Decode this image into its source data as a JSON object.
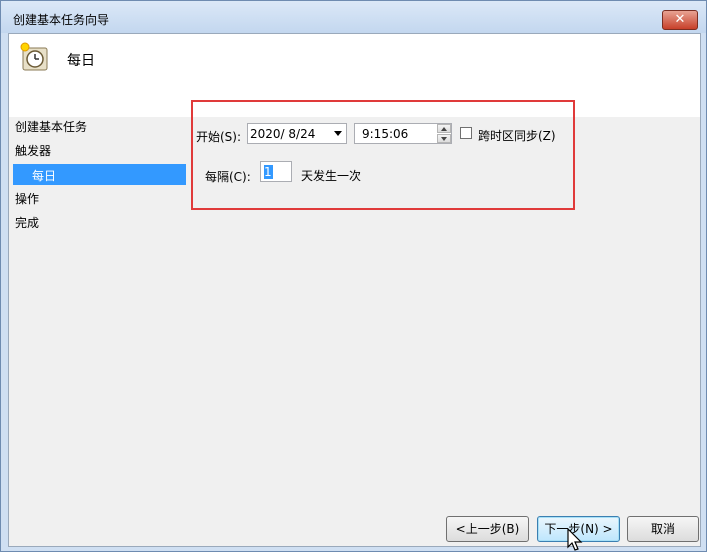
{
  "window": {
    "title": "创建基本任务向导",
    "close_symbol": "✕"
  },
  "header": {
    "title": "每日",
    "icon": "clock-icon"
  },
  "nav": {
    "items": [
      {
        "label": "创建基本任务",
        "selected": false
      },
      {
        "label": "触发器",
        "selected": false
      },
      {
        "label": "每日",
        "selected": true
      },
      {
        "label": "操作",
        "selected": false
      },
      {
        "label": "完成",
        "selected": false
      }
    ]
  },
  "form": {
    "start_label": "开始(S):",
    "date_value": "2020/  8/24",
    "time_value": "9:15:06",
    "sync_timezone_label": "跨时区同步(Z)",
    "sync_timezone_checked": false,
    "interval_label": "每隔(C):",
    "interval_value": "1",
    "interval_suffix": "天发生一次"
  },
  "buttons": {
    "back": "<上一步(B)",
    "next": "下一步(N) >",
    "cancel": "取消"
  },
  "colors": {
    "selection": "#3399ff",
    "highlight_box": "#e03a3a"
  }
}
